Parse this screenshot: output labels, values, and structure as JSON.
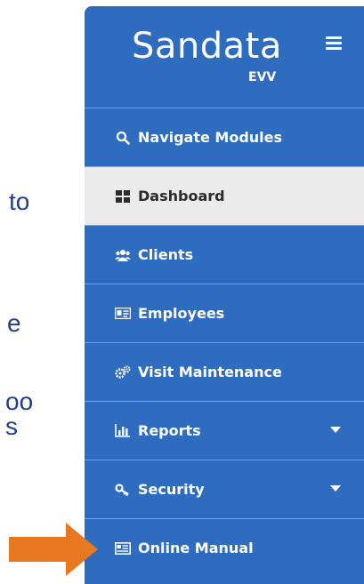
{
  "slide": {
    "fragments": [
      "to",
      "e",
      "oo",
      "s"
    ]
  },
  "sidebar": {
    "brand": "Sandata",
    "brand_sub": "EVV",
    "items": [
      {
        "label": "Navigate Modules",
        "icon": "search-icon"
      },
      {
        "label": "Dashboard",
        "icon": "dashboard-icon",
        "active": true
      },
      {
        "label": "Clients",
        "icon": "users-icon"
      },
      {
        "label": "Employees",
        "icon": "id-card-icon"
      },
      {
        "label": "Visit Maintenance",
        "icon": "cogs-icon"
      },
      {
        "label": "Reports",
        "icon": "bar-chart-icon",
        "expandable": true
      },
      {
        "label": "Security",
        "icon": "key-icon",
        "expandable": true
      },
      {
        "label": "Online Manual",
        "icon": "book-icon"
      }
    ]
  },
  "colors": {
    "sidebar_bg": "#2e6cc0",
    "active_bg": "#ebebeb",
    "arrow": "#e87722",
    "slide_text": "#1f3f8f"
  }
}
